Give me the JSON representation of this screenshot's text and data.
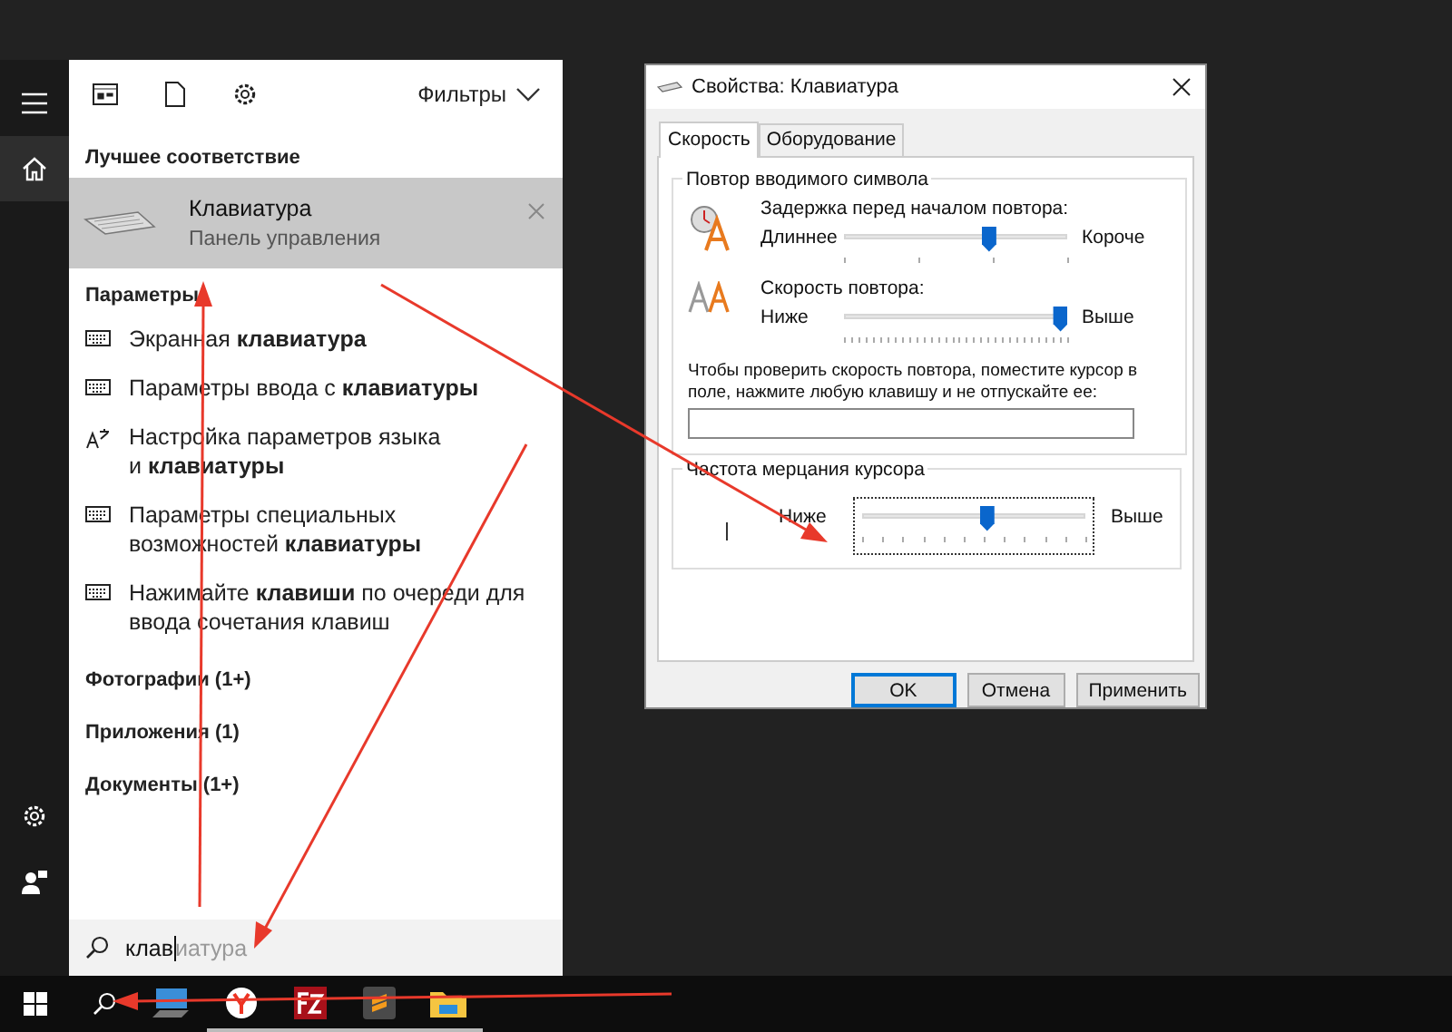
{
  "start_menu": {
    "rail": [
      {
        "kind": "menu",
        "selected": false
      },
      {
        "kind": "home",
        "selected": true
      },
      {
        "kind": "settings",
        "selected": false
      },
      {
        "kind": "user",
        "selected": false
      }
    ],
    "toolbar": {
      "tools": [
        {
          "kind": "apps"
        },
        {
          "kind": "document"
        },
        {
          "kind": "settings"
        }
      ],
      "filter_label": "Фильтры"
    },
    "best_match_heading": "Лучшее соответствие",
    "best_match": {
      "title": "Клавиатура",
      "subtitle": "Панель управления",
      "selected": true
    },
    "sections": [
      {
        "heading": "Параметры",
        "items": [
          {
            "kind": "keyboard",
            "lines": [
              "Экранная **клавиатура**"
            ]
          },
          {
            "kind": "keyboard",
            "lines": [
              "Параметры ввода с **клавиатуры**"
            ]
          },
          {
            "kind": "language",
            "lines": [
              "Настройка параметров языка",
              "и **клавиатуры**"
            ]
          },
          {
            "kind": "keyboard",
            "lines": [
              "Параметры специальных",
              "возможностей **клавиатуры**"
            ]
          },
          {
            "kind": "keyboard",
            "lines": [
              "Нажимайте **клавиши** по очереди для",
              "ввода сочетания клавиш"
            ]
          }
        ]
      },
      {
        "heading": "Фотографии (1+)"
      },
      {
        "heading": "Приложения (1)"
      },
      {
        "heading": "Документы (1+)"
      }
    ],
    "search": {
      "value": "клав",
      "suggestion": "иатура"
    }
  },
  "dialog": {
    "title": "Свойства: Клавиатура",
    "tabs": [
      {
        "label": "Скорость",
        "selected": true
      },
      {
        "label": "Оборудование",
        "selected": false
      }
    ],
    "repeat_group": {
      "title": "Повтор вводимого символа",
      "sliders": [
        {
          "kind": "delay",
          "label": "Задержка перед началом повтора:",
          "low": "Длиннее",
          "high": "Короче",
          "level": 0.65
        },
        {
          "kind": "rate",
          "label": "Скорость повтора:",
          "low": "Ниже",
          "high": "Выше",
          "level": 0.97
        }
      ],
      "test_label": "Чтобы проверить скорость повтора, поместите курсор в поле, нажмите любую клавишу и не отпускайте ее:"
    },
    "blink_group": {
      "title": "Частота мерцания курсора",
      "low": "Ниже",
      "high": "Выше",
      "level": 0.56,
      "focused": true
    },
    "buttons": [
      {
        "label": "OK",
        "default": true
      },
      {
        "label": "Отмена",
        "default": false
      },
      {
        "label": "Применить",
        "default": false
      }
    ]
  },
  "taskbar": {
    "apps": [
      {
        "kind": "computer",
        "running": false
      },
      {
        "kind": "browser",
        "running": true
      },
      {
        "kind": "ftp",
        "running": true
      },
      {
        "kind": "editor",
        "running": true
      },
      {
        "kind": "folder",
        "running": true
      }
    ]
  }
}
